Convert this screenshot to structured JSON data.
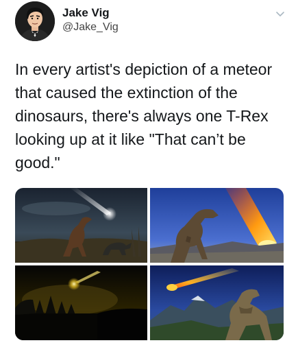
{
  "tweet": {
    "display_name": "Jake Vig",
    "handle": "@Jake_Vig",
    "avatar_icon": "cartoon-spy-avatar",
    "menu_icon": "chevron-down-icon",
    "text": "In every artist's depiction of a meteor\nthat caused the extinction of the\ndinosaurs, there's always one T-Rex\nlooking up at it like \"That can’t be\ngood.\"",
    "media": [
      {
        "icon": "meteor-over-dinosaurs-night-photo"
      },
      {
        "icon": "trex-looking-at-meteor-photo"
      },
      {
        "icon": "meteor-over-forest-photo"
      },
      {
        "icon": "dinosaur-meteor-over-mountains-photo"
      }
    ]
  },
  "colors": {
    "text": "#14171a",
    "secondary": "#444444",
    "chevron": "#aab8c2"
  }
}
